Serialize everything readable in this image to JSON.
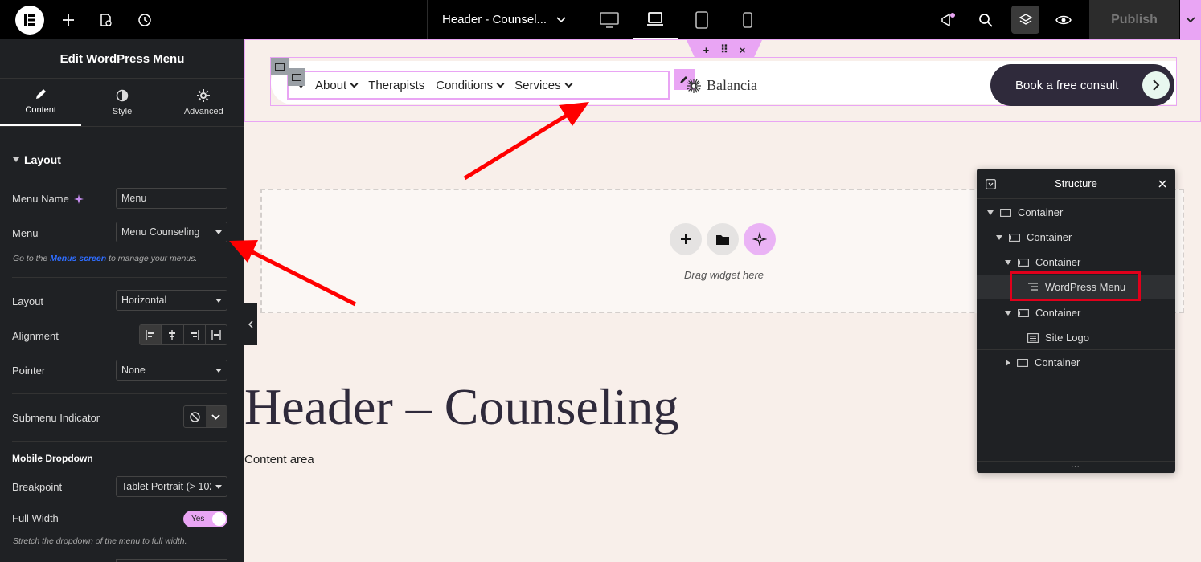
{
  "topbar": {
    "doc_title": "Header - Counsel...",
    "publish_label": "Publish"
  },
  "panel": {
    "title": "Edit WordPress Menu",
    "tabs": [
      {
        "label": "Content",
        "icon": "pencil-icon"
      },
      {
        "label": "Style",
        "icon": "half-circle-icon"
      },
      {
        "label": "Advanced",
        "icon": "gear-icon"
      }
    ],
    "section_layout": "Layout",
    "menu_name_label": "Menu Name",
    "menu_name_value": "Menu",
    "menu_label": "Menu",
    "menu_value": "Menu Counseling",
    "hint_prefix": "Go to the ",
    "hint_link": "Menus screen",
    "hint_suffix": " to manage your menus.",
    "layout_label": "Layout",
    "layout_value": "Horizontal",
    "alignment_label": "Alignment",
    "pointer_label": "Pointer",
    "pointer_value": "None",
    "submenu_indicator_label": "Submenu Indicator",
    "mobile_dropdown_title": "Mobile Dropdown",
    "breakpoint_label": "Breakpoint",
    "breakpoint_value": "Tablet Portrait (> 102",
    "full_width_label": "Full Width",
    "full_width_value": "Yes",
    "full_width_hint": "Stretch the dropdown of the menu to full width."
  },
  "canvas": {
    "menu_items": [
      "About",
      "Therapists",
      "Conditions",
      "Services"
    ],
    "brand_name": "Balancia",
    "cta_label": "Book a free consult",
    "drag_hint": "Drag widget here",
    "page_heading": "Header – Counseling",
    "content_text": "Content area"
  },
  "structure": {
    "title": "Structure",
    "items": [
      {
        "label": "Container",
        "depth": 0,
        "expanded": true
      },
      {
        "label": "Container",
        "depth": 1,
        "expanded": true
      },
      {
        "label": "Container",
        "depth": 2,
        "expanded": true
      },
      {
        "label": "WordPress Menu",
        "depth": 3,
        "selected": true
      },
      {
        "label": "Container",
        "depth": 2,
        "expanded": true
      },
      {
        "label": "Site Logo",
        "depth": 3
      },
      {
        "label": "Container",
        "depth": 2,
        "expanded": false
      }
    ]
  },
  "colors": {
    "accent_pink": "#e9a5f4",
    "panel_bg": "#1f2124",
    "canvas_bg": "#f8efea",
    "cta_bg": "#2f2a3b",
    "annotation_red": "#e0001b"
  }
}
